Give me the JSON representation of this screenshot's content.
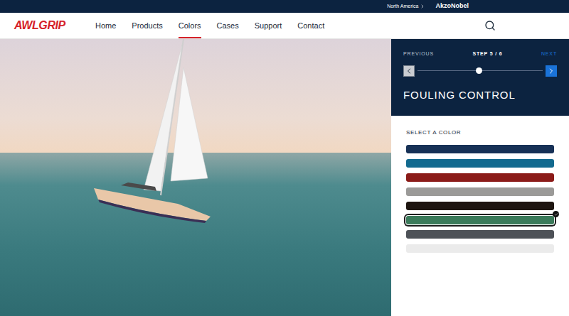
{
  "top_bar": {
    "region": "North America",
    "brand": "AkzoNobel"
  },
  "logo": "AWLGRIP",
  "nav": [
    {
      "label": "Home",
      "selected": false
    },
    {
      "label": "Products",
      "selected": false
    },
    {
      "label": "Colors",
      "selected": true
    },
    {
      "label": "Cases",
      "selected": false
    },
    {
      "label": "Support",
      "selected": false
    },
    {
      "label": "Contact",
      "selected": false
    }
  ],
  "stepper": {
    "previous": "PREVIOUS",
    "step": "STEP 5 / 6",
    "next": "NEXT",
    "level": 0.49
  },
  "title": "FOULING CONTROL",
  "section_label": "SELECT A COLOR",
  "swatches": [
    {
      "color": "#173156",
      "selected": false
    },
    {
      "color": "#126a8f",
      "selected": false
    },
    {
      "color": "#8b1b18",
      "selected": false
    },
    {
      "color": "#9b9a98",
      "selected": false
    },
    {
      "color": "#1e1510",
      "selected": false
    },
    {
      "color": "#3a7a5a",
      "selected": true
    },
    {
      "color": "#4d5157",
      "selected": false
    },
    {
      "color": "#ebebeb",
      "selected": false
    }
  ]
}
